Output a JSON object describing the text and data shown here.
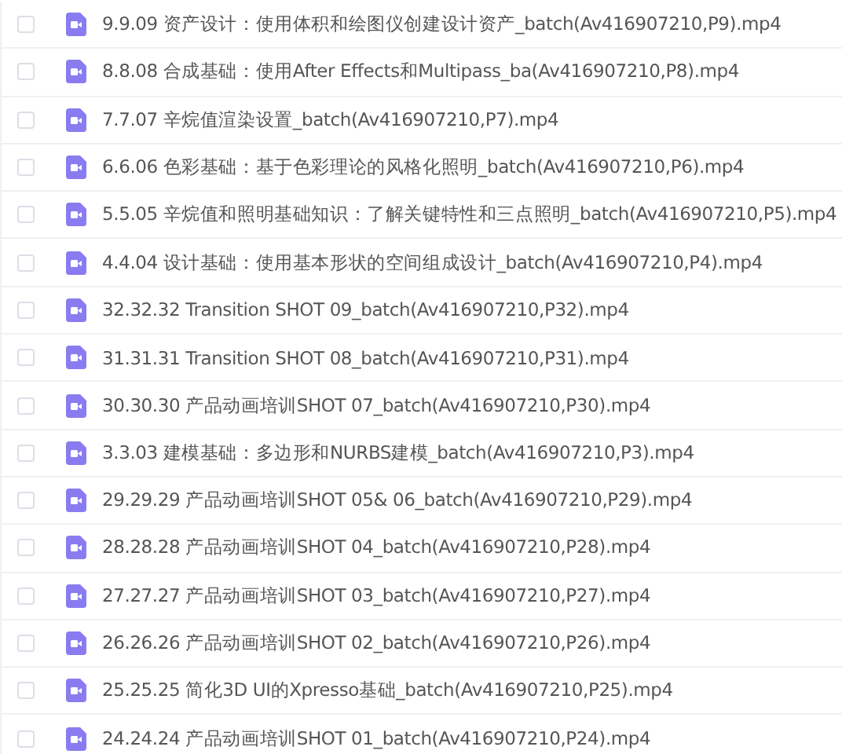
{
  "files": [
    {
      "name": "9.9.09 资产设计：使用体积和绘图仪创建设计资产_batch(Av416907210,P9).mp4",
      "checked": false
    },
    {
      "name": "8.8.08 合成基础：使用After Effects和Multipass_ba(Av416907210,P8).mp4",
      "checked": false
    },
    {
      "name": "7.7.07 辛烷值渲染设置_batch(Av416907210,P7).mp4",
      "checked": false
    },
    {
      "name": "6.6.06 色彩基础：基于色彩理论的风格化照明_batch(Av416907210,P6).mp4",
      "checked": false
    },
    {
      "name": "5.5.05 辛烷值和照明基础知识：了解关键特性和三点照明_batch(Av416907210,P5).mp4",
      "checked": false
    },
    {
      "name": "4.4.04 设计基础：使用基本形状的空间组成设计_batch(Av416907210,P4).mp4",
      "checked": false
    },
    {
      "name": "32.32.32 Transition SHOT 09_batch(Av416907210,P32).mp4",
      "checked": false
    },
    {
      "name": "31.31.31 Transition SHOT 08_batch(Av416907210,P31).mp4",
      "checked": false
    },
    {
      "name": "30.30.30 产品动画培训SHOT 07_batch(Av416907210,P30).mp4",
      "checked": false
    },
    {
      "name": "3.3.03 建模基础：多边形和NURBS建模_batch(Av416907210,P3).mp4",
      "checked": false
    },
    {
      "name": "29.29.29 产品动画培训SHOT 05& 06_batch(Av416907210,P29).mp4",
      "checked": false
    },
    {
      "name": "28.28.28 产品动画培训SHOT 04_batch(Av416907210,P28).mp4",
      "checked": false
    },
    {
      "name": "27.27.27 产品动画培训SHOT 03_batch(Av416907210,P27).mp4",
      "checked": false
    },
    {
      "name": "26.26.26 产品动画培训SHOT 02_batch(Av416907210,P26).mp4",
      "checked": false
    },
    {
      "name": "25.25.25 简化3D UI的Xpresso基础_batch(Av416907210,P25).mp4",
      "checked": false
    },
    {
      "name": "24.24.24 产品动画培训SHOT 01_batch(Av416907210,P24).mp4",
      "checked": false
    }
  ]
}
